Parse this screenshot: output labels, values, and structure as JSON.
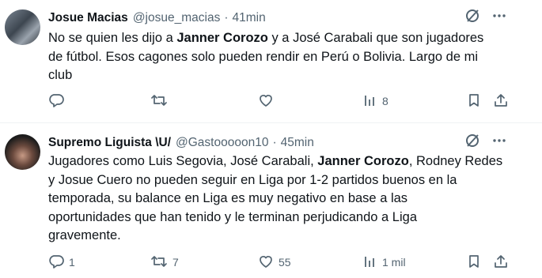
{
  "tweets": [
    {
      "name": "Josue Macias",
      "handle": "@josue_macias",
      "separator": "·",
      "time": "41min",
      "text_parts": [
        "No se quien les dijo a ",
        "Janner Corozo",
        " y a José Carabali que son jugadores\nde fútbol. Esos cagones solo pueden rendir en Perú o Bolivia. Largo de mi\nclub"
      ],
      "replies": "",
      "retweets": "",
      "likes": "",
      "views": "8"
    },
    {
      "name": "Supremo Liguista \\U/",
      "handle": "@Gastooooon10",
      "separator": "·",
      "time": "45min",
      "text_parts": [
        "Jugadores como Luis Segovia, José Carabali, ",
        "Janner Corozo",
        ", Rodney Redes\ny Josue Cuero no pueden seguir en Liga por 1-2 partidos buenos en la\ntemporada, su balance en Liga es muy negativo en base a las\noportunidades que han tenido y le terminan perjudicando a Liga\ngravemente."
      ],
      "replies": "1",
      "retweets": "7",
      "likes": "55",
      "views": "1 mil"
    }
  ],
  "icons": {
    "reply": "reply-icon",
    "retweet": "retweet-icon",
    "like": "heart-icon",
    "views": "views-icon",
    "bookmark": "bookmark-icon",
    "share": "share-icon",
    "grok": "grok-icon",
    "more": "more-icon"
  },
  "colors": {
    "text": "#0f1419",
    "secondary": "#536471",
    "divider": "#eff3f4"
  }
}
